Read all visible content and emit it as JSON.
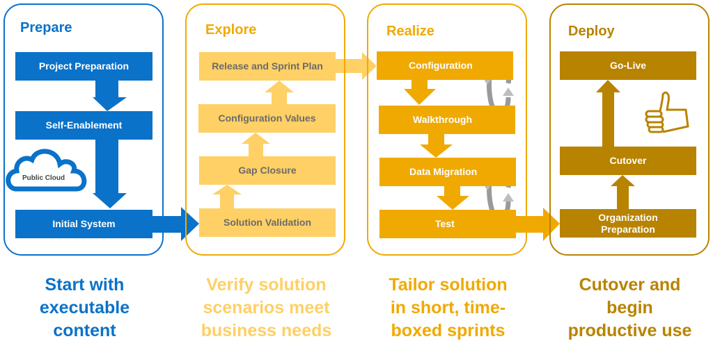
{
  "colors": {
    "prepare": "#0a72c9",
    "explore": "#fed065",
    "explore_title": "#f2a900",
    "explore_text": "#6b6b6b",
    "realize": "#f0a900",
    "deploy": "#b88300",
    "cycle": "#a6a6a6"
  },
  "phases": [
    {
      "title": "Prepare",
      "steps": [
        "Project Preparation",
        "Self-Enablement",
        "Initial System"
      ],
      "badge": "Public Cloud",
      "tagline": [
        "Start with",
        "executable",
        "content"
      ]
    },
    {
      "title": "Explore",
      "steps": [
        "Release and Sprint Plan",
        "Configuration Values",
        "Gap Closure",
        "Solution Validation"
      ],
      "tagline": [
        "Verify solution",
        "scenarios meet",
        "business needs"
      ]
    },
    {
      "title": "Realize",
      "steps": [
        "Configuration",
        "Walkthrough",
        "Data Migration",
        "Test"
      ],
      "tagline": [
        "Tailor solution",
        "in short, time-",
        "boxed sprints"
      ]
    },
    {
      "title": "Deploy",
      "steps": [
        "Go-Live",
        "Cutover",
        "Organization Preparation"
      ],
      "tagline": [
        "Cutover and",
        "begin",
        "productive use"
      ]
    }
  ],
  "icons": {
    "cloud": "cloud-icon",
    "cycle": "cycle-arrows-icon",
    "thumbs": "thumbs-up-icon"
  }
}
